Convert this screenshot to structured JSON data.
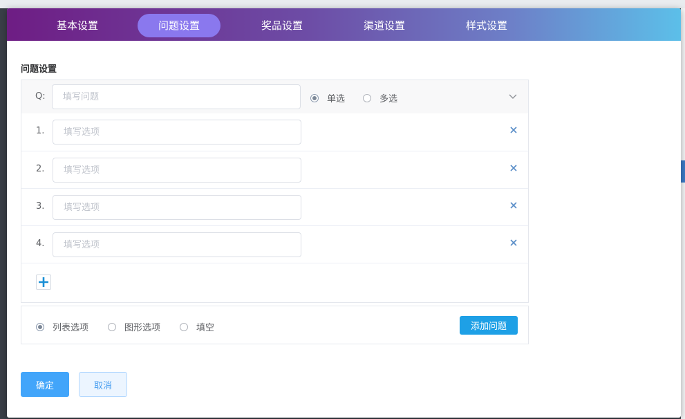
{
  "tabs": [
    {
      "label": "基本设置"
    },
    {
      "label": "问题设置",
      "active": true
    },
    {
      "label": "奖品设置"
    },
    {
      "label": "渠道设置"
    },
    {
      "label": "样式设置"
    }
  ],
  "section_title": "问题设置",
  "question": {
    "prefix": "Q:",
    "placeholder": "填写问题",
    "mode_single": "单选",
    "mode_multi": "多选",
    "selected_mode": "单选"
  },
  "options": [
    {
      "num": "1.",
      "placeholder": "填写选项"
    },
    {
      "num": "2.",
      "placeholder": "填写选项"
    },
    {
      "num": "3.",
      "placeholder": "填写选项"
    },
    {
      "num": "4.",
      "placeholder": "填写选项"
    }
  ],
  "answer_types": {
    "list": "列表选项",
    "image": "图形选项",
    "blank": "填空",
    "selected": "列表选项"
  },
  "buttons": {
    "add_question": "添加问题",
    "confirm": "确定",
    "cancel": "取消"
  },
  "colors": {
    "accent": "#1ea0e6",
    "primary": "#42a5fa",
    "tab_active": "#8a78ee"
  },
  "icons": {
    "add": "plus-icon",
    "remove": "close-icon",
    "expand": "chevron-down-icon"
  }
}
